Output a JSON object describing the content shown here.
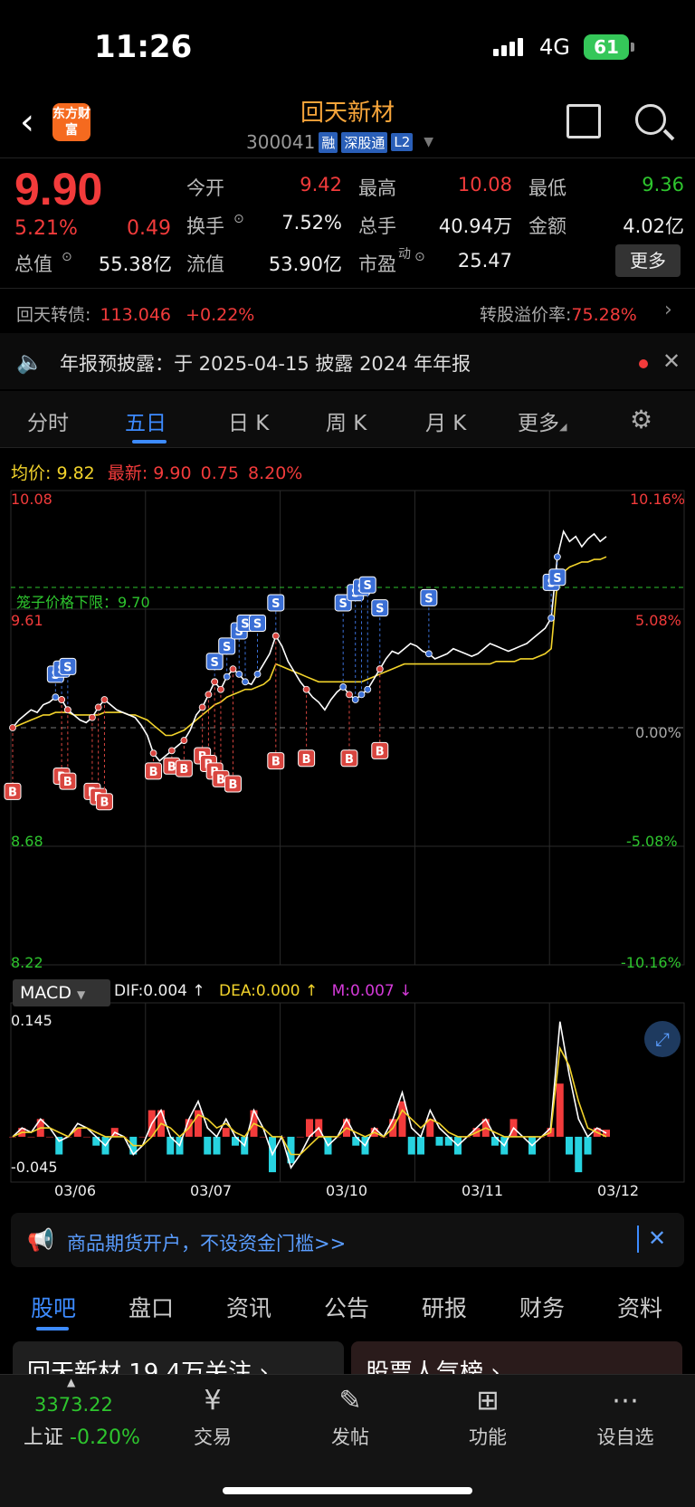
{
  "status": {
    "time": "11:26",
    "network": "4G",
    "battery": "61"
  },
  "header": {
    "logo": "东方财富",
    "stock_name": "回天新材",
    "code": "300041",
    "tags": [
      "融",
      "深股通",
      "L2"
    ]
  },
  "quote": {
    "price": "9.90",
    "change_pct": "5.21%",
    "change": "0.49",
    "fields": [
      {
        "label": "今开",
        "value": "9.42",
        "color": "red"
      },
      {
        "label": "最高",
        "value": "10.08",
        "color": "red"
      },
      {
        "label": "最低",
        "value": "9.36",
        "color": "green"
      },
      {
        "label": "换手",
        "value": "7.52%",
        "color": "white"
      },
      {
        "label": "总手",
        "value": "40.94万",
        "color": "white"
      },
      {
        "label": "金额",
        "value": "4.02亿",
        "color": "white"
      },
      {
        "label": "总值",
        "value": "55.38亿",
        "color": "white"
      },
      {
        "label": "流值",
        "value": "53.90亿",
        "color": "white"
      },
      {
        "label": "市盈",
        "value": "25.47",
        "color": "white"
      }
    ],
    "pe_sup": "动",
    "more_label": "更多"
  },
  "bond": {
    "label": "回天转债:",
    "price": "113.046",
    "change": "+0.22%",
    "premium_label": "转股溢价率:",
    "premium_value": "75.28%"
  },
  "notice": {
    "text": "年报预披露：于 2025-04-15 披露 2024 年年报"
  },
  "tabs": [
    "分时",
    "五日",
    "日 K",
    "周 K",
    "月 K",
    "更多"
  ],
  "active_tab": "五日",
  "chart_legend": {
    "avg_label": "均价:",
    "avg_value": "9.82",
    "latest_label": "最新:",
    "latest_value": "9.90",
    "latest_change": "0.75",
    "latest_pct": "8.20%"
  },
  "chart_data": {
    "type": "line",
    "y_left_ticks": [
      "10.08",
      "9.61",
      "8.68",
      "8.22"
    ],
    "y_right_ticks": [
      "10.16%",
      "5.08%",
      "0.00%",
      "-5.08%",
      "-10.16%"
    ],
    "ylim": [
      8.22,
      10.08
    ],
    "prev_close": 9.15,
    "cage_limit_label": "笼子价格下限：9.70",
    "cage_limit": 9.7,
    "x_labels": [
      "03/06",
      "03/07",
      "03/10",
      "03/11",
      "03/12"
    ],
    "series": [
      {
        "name": "最新",
        "values": [
          9.15,
          9.18,
          9.2,
          9.22,
          9.21,
          9.24,
          9.25,
          9.27,
          9.26,
          9.22,
          9.2,
          9.18,
          9.17,
          9.19,
          9.23,
          9.26,
          9.24,
          9.22,
          9.21,
          9.2,
          9.19,
          9.16,
          9.12,
          9.05,
          9.02,
          9.04,
          9.06,
          9.08,
          9.1,
          9.14,
          9.2,
          9.23,
          9.28,
          9.33,
          9.3,
          9.35,
          9.38,
          9.36,
          9.33,
          9.32,
          9.36,
          9.4,
          9.44,
          9.51,
          9.47,
          9.41,
          9.37,
          9.33,
          9.3,
          9.27,
          9.25,
          9.22,
          9.26,
          9.29,
          9.31,
          9.28,
          9.26,
          9.28,
          9.3,
          9.34,
          9.38,
          9.42,
          9.45,
          9.44,
          9.46,
          9.48,
          9.47,
          9.45,
          9.44,
          9.42,
          9.43,
          9.44,
          9.46,
          9.45,
          9.44,
          9.43,
          9.44,
          9.46,
          9.48,
          9.47,
          9.46,
          9.45,
          9.46,
          9.47,
          9.48,
          9.5,
          9.52,
          9.54,
          9.58,
          9.82,
          9.92,
          9.88,
          9.9,
          9.86,
          9.89,
          9.91,
          9.88,
          9.9
        ]
      },
      {
        "name": "均价",
        "values": [
          9.15,
          9.16,
          9.17,
          9.18,
          9.19,
          9.2,
          9.2,
          9.21,
          9.21,
          9.21,
          9.2,
          9.2,
          9.2,
          9.2,
          9.2,
          9.21,
          9.21,
          9.21,
          9.21,
          9.2,
          9.2,
          9.19,
          9.18,
          9.16,
          9.14,
          9.12,
          9.12,
          9.13,
          9.14,
          9.16,
          9.18,
          9.2,
          9.22,
          9.24,
          9.25,
          9.27,
          9.28,
          9.29,
          9.3,
          9.3,
          9.31,
          9.32,
          9.34,
          9.4,
          9.39,
          9.38,
          9.37,
          9.36,
          9.35,
          9.34,
          9.33,
          9.33,
          9.33,
          9.33,
          9.33,
          9.33,
          9.33,
          9.33,
          9.34,
          9.35,
          9.36,
          9.37,
          9.38,
          9.39,
          9.4,
          9.4,
          9.4,
          9.4,
          9.4,
          9.4,
          9.4,
          9.4,
          9.4,
          9.4,
          9.4,
          9.4,
          9.4,
          9.4,
          9.4,
          9.41,
          9.41,
          9.41,
          9.41,
          9.42,
          9.42,
          9.42,
          9.43,
          9.44,
          9.46,
          9.72,
          9.76,
          9.78,
          9.79,
          9.8,
          9.8,
          9.81,
          9.81,
          9.82
        ]
      }
    ],
    "markers": {
      "sell": [
        [
          7,
          9.36
        ],
        [
          8,
          9.38
        ],
        [
          9,
          9.39
        ],
        [
          33,
          9.41
        ],
        [
          35,
          9.47
        ],
        [
          37,
          9.53
        ],
        [
          38,
          9.56
        ],
        [
          40,
          9.56
        ],
        [
          43,
          9.64
        ],
        [
          54,
          9.64
        ],
        [
          56,
          9.68
        ],
        [
          57,
          9.7
        ],
        [
          58,
          9.71
        ],
        [
          60,
          9.62
        ],
        [
          68,
          9.66
        ],
        [
          88,
          9.72
        ],
        [
          89,
          9.74
        ]
      ],
      "buy": [
        [
          0,
          8.9
        ],
        [
          8,
          8.96
        ],
        [
          9,
          8.94
        ],
        [
          13,
          8.9
        ],
        [
          14,
          8.88
        ],
        [
          15,
          8.86
        ],
        [
          23,
          8.98
        ],
        [
          26,
          9.0
        ],
        [
          28,
          8.99
        ],
        [
          31,
          9.04
        ],
        [
          32,
          9.01
        ],
        [
          33,
          8.98
        ],
        [
          34,
          8.95
        ],
        [
          36,
          8.93
        ],
        [
          43,
          9.02
        ],
        [
          48,
          9.03
        ],
        [
          55,
          9.03
        ],
        [
          60,
          9.06
        ]
      ]
    }
  },
  "macd": {
    "label": "MACD",
    "dif": "DIF:0.004 ↑",
    "dea": "DEA:0.000 ↑",
    "m": "M:0.007 ↓",
    "y_top": "0.145",
    "y_bottom": "-0.045",
    "ylim": [
      -0.045,
      0.145
    ],
    "dif_values": [
      0.0,
      0.01,
      0.005,
      0.02,
      0.01,
      -0.005,
      0.0,
      0.015,
      0.01,
      0.0,
      -0.01,
      0.005,
      0.0,
      -0.02,
      -0.01,
      0.015,
      0.03,
      0.0,
      -0.01,
      0.02,
      0.04,
      0.01,
      0.0,
      0.02,
      0.0,
      -0.01,
      0.03,
      0.01,
      -0.02,
      0.0,
      -0.035,
      -0.02,
      0.0,
      0.01,
      -0.01,
      0.0,
      0.02,
      0.0,
      -0.01,
      0.01,
      0.0,
      0.02,
      0.05,
      0.01,
      0.0,
      0.03,
      0.01,
      0.0,
      -0.01,
      0.0,
      0.01,
      0.02,
      0.0,
      -0.01,
      0.01,
      0.0,
      -0.01,
      0.0,
      0.01,
      0.13,
      0.07,
      0.02,
      0.0,
      0.01,
      0.004
    ],
    "dea_values": [
      0.0,
      0.005,
      0.005,
      0.01,
      0.01,
      0.005,
      0.0,
      0.01,
      0.01,
      0.005,
      0.0,
      0.0,
      0.0,
      -0.01,
      -0.01,
      0.0,
      0.015,
      0.01,
      0.0,
      0.01,
      0.025,
      0.02,
      0.01,
      0.015,
      0.005,
      0.0,
      0.015,
      0.01,
      0.0,
      0.0,
      -0.02,
      -0.02,
      -0.01,
      0.0,
      0.0,
      0.0,
      0.01,
      0.005,
      0.0,
      0.005,
      0.0,
      0.01,
      0.03,
      0.02,
      0.01,
      0.02,
      0.015,
      0.005,
      0.0,
      0.0,
      0.005,
      0.01,
      0.005,
      0.0,
      0.0,
      0.0,
      0.0,
      0.0,
      0.005,
      0.1,
      0.08,
      0.04,
      0.01,
      0.005,
      0.0
    ]
  },
  "ad": {
    "text": "商品期货开户，不设资金门槛>>"
  },
  "subtabs": [
    "股吧",
    "盘口",
    "资讯",
    "公告",
    "研报",
    "财务",
    "资料"
  ],
  "cards": {
    "left": "回天新材 19.4万关注 ›",
    "right": "股票人气榜 ›"
  },
  "bottom_nav": {
    "index_value": "3373.22",
    "index_name": "上证",
    "index_change": "-0.20%",
    "items": [
      "交易",
      "发帖",
      "功能",
      "设自选"
    ]
  },
  "colors": {
    "up": "#f23b3b",
    "down": "#2ec52e",
    "accent": "#3d8bff",
    "avg": "#f2d32b"
  },
  "icons": [
    "back-arrow-icon",
    "share-icon",
    "search-icon",
    "speaker-icon",
    "gear-icon",
    "megaphone-icon",
    "yen-icon",
    "edit-icon",
    "grid-icon",
    "more-dots-icon"
  ]
}
